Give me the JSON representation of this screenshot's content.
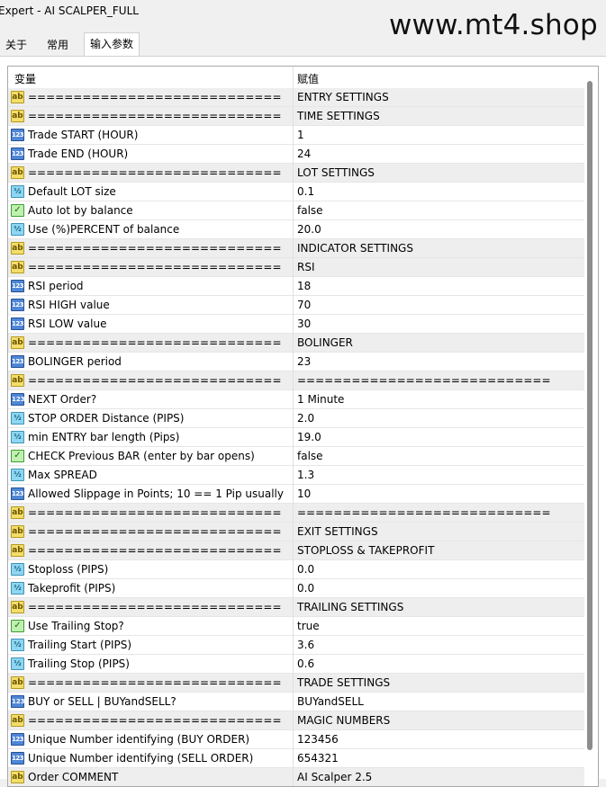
{
  "window": {
    "title": "Expert - AI SCALPER_FULL",
    "watermark": "www.mt4.shop"
  },
  "tabs": [
    {
      "label": "关于",
      "active": false
    },
    {
      "label": "常用",
      "active": false
    },
    {
      "label": "输入参数",
      "active": true
    }
  ],
  "table": {
    "columns": [
      "变量",
      "赋值"
    ],
    "rows": [
      {
        "type": "str",
        "icon": "ab",
        "name": "============================",
        "value": "ENTRY SETTINGS"
      },
      {
        "type": "str",
        "icon": "ab",
        "name": "============================",
        "value": "TIME SETTINGS"
      },
      {
        "type": "int",
        "icon": "123",
        "name": "Trade START (HOUR)",
        "value": "1"
      },
      {
        "type": "int",
        "icon": "123",
        "name": "Trade END (HOUR)",
        "value": "24"
      },
      {
        "type": "str",
        "icon": "ab",
        "name": "============================",
        "value": "LOT SETTINGS"
      },
      {
        "type": "dbl",
        "icon": "½",
        "name": "Default LOT size",
        "value": "0.1"
      },
      {
        "type": "bool",
        "icon": "✓",
        "name": "Auto lot by balance",
        "value": "false"
      },
      {
        "type": "dbl",
        "icon": "½",
        "name": "Use (%)PERCENT of balance",
        "value": "20.0"
      },
      {
        "type": "str",
        "icon": "ab",
        "name": "============================",
        "value": "INDICATOR SETTINGS"
      },
      {
        "type": "str",
        "icon": "ab",
        "name": "============================",
        "value": "RSI"
      },
      {
        "type": "int",
        "icon": "123",
        "name": "RSI period",
        "value": "18"
      },
      {
        "type": "int",
        "icon": "123",
        "name": "RSI HIGH value",
        "value": "70"
      },
      {
        "type": "int",
        "icon": "123",
        "name": "RSI LOW value",
        "value": "30"
      },
      {
        "type": "str",
        "icon": "ab",
        "name": "============================",
        "value": "BOLINGER"
      },
      {
        "type": "int",
        "icon": "123",
        "name": "BOLINGER period",
        "value": "23"
      },
      {
        "type": "str",
        "icon": "ab",
        "name": "============================",
        "value": "============================"
      },
      {
        "type": "enum",
        "icon": "123",
        "name": "NEXT Order?",
        "value": "1 Minute"
      },
      {
        "type": "dbl",
        "icon": "½",
        "name": "STOP ORDER Distance (PIPS)",
        "value": "2.0"
      },
      {
        "type": "dbl",
        "icon": "½",
        "name": "min ENTRY bar length (Pips)",
        "value": "19.0"
      },
      {
        "type": "bool",
        "icon": "✓",
        "name": "CHECK Previous BAR (enter by bar opens)",
        "value": "false"
      },
      {
        "type": "dbl",
        "icon": "½",
        "name": "Max SPREAD",
        "value": "1.3"
      },
      {
        "type": "int",
        "icon": "123",
        "name": "Allowed Slippage in Points; 10 == 1 Pip usually",
        "value": "10"
      },
      {
        "type": "str",
        "icon": "ab",
        "name": "============================",
        "value": "============================"
      },
      {
        "type": "str",
        "icon": "ab",
        "name": "============================",
        "value": "EXIT SETTINGS"
      },
      {
        "type": "str",
        "icon": "ab",
        "name": "============================",
        "value": "STOPLOSS & TAKEPROFIT"
      },
      {
        "type": "dbl",
        "icon": "½",
        "name": "Stoploss (PIPS)",
        "value": "0.0"
      },
      {
        "type": "dbl",
        "icon": "½",
        "name": "Takeprofit (PIPS)",
        "value": "0.0"
      },
      {
        "type": "str",
        "icon": "ab",
        "name": "============================",
        "value": "TRAILING SETTINGS"
      },
      {
        "type": "bool",
        "icon": "✓",
        "name": "Use Trailing Stop?",
        "value": "true"
      },
      {
        "type": "dbl",
        "icon": "½",
        "name": "Trailing Start (PIPS)",
        "value": "3.6"
      },
      {
        "type": "dbl",
        "icon": "½",
        "name": "Trailing Stop (PIPS)",
        "value": "0.6"
      },
      {
        "type": "str",
        "icon": "ab",
        "name": "============================",
        "value": "TRADE SETTINGS"
      },
      {
        "type": "enum",
        "icon": "123",
        "name": "BUY or SELL | BUYandSELL?",
        "value": "BUYandSELL"
      },
      {
        "type": "str",
        "icon": "ab",
        "name": "============================",
        "value": "MAGIC NUMBERS"
      },
      {
        "type": "int",
        "icon": "123",
        "name": "Unique Number identifying (BUY ORDER)",
        "value": "123456"
      },
      {
        "type": "int",
        "icon": "123",
        "name": "Unique Number identifying (SELL ORDER)",
        "value": "654321"
      },
      {
        "type": "str",
        "icon": "ab",
        "name": "Order COMMENT",
        "value": "AI Scalper 2.5"
      }
    ]
  }
}
